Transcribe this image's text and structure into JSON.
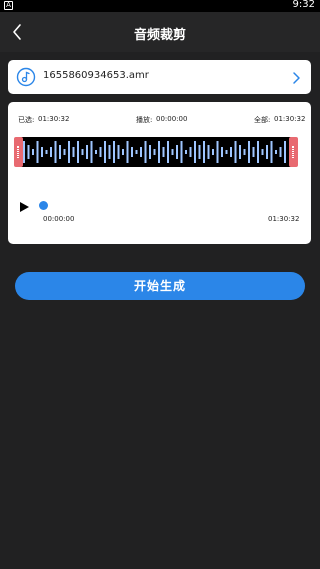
{
  "status_bar": {
    "badge": "A",
    "time": "9:32"
  },
  "header": {
    "title": "音频裁剪",
    "back_icon": "back-arrow-icon"
  },
  "file": {
    "name": "1655860934653.amr",
    "icon": "music-note-icon",
    "chevron_icon": "chevron-right-icon"
  },
  "editor": {
    "selected_label": "已选:",
    "selected_value": "01:30:32",
    "playing_label": "播放:",
    "playing_value": "00:00:00",
    "total_label": "全部:",
    "total_value": "01:30:32",
    "start_time": "00:00:00",
    "end_time": "01:30:32",
    "progress": 0
  },
  "actions": {
    "start_label": "开始生成"
  },
  "colors": {
    "accent": "#2b86e8",
    "handle": "#e86a71",
    "wave": "#9fc6ff",
    "background": "#212122"
  }
}
